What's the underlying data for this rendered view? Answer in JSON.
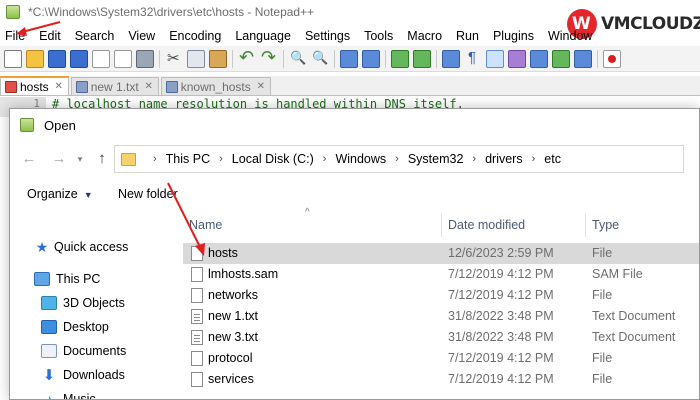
{
  "npp": {
    "title": "*C:\\Windows\\System32\\drivers\\etc\\hosts - Notepad++",
    "menu": [
      "File",
      "Edit",
      "Search",
      "View",
      "Encoding",
      "Language",
      "Settings",
      "Tools",
      "Macro",
      "Run",
      "Plugins",
      "Window"
    ],
    "tabs": [
      {
        "label": "hosts",
        "active": true
      },
      {
        "label": "new 1.txt",
        "active": false
      },
      {
        "label": "known_hosts",
        "active": false
      }
    ],
    "editor": {
      "line_number": "1",
      "code_line": "# localhost name resolution is handled within DNS itself."
    }
  },
  "logo": {
    "text": "VMCLOUDZ",
    "brand_color": "#e6262d"
  },
  "dialog": {
    "title": "Open",
    "breadcrumb": [
      "This PC",
      "Local Disk (C:)",
      "Windows",
      "System32",
      "drivers",
      "etc"
    ],
    "organize_label": "Organize",
    "new_folder_label": "New folder",
    "nav": [
      {
        "label": "Quick access",
        "icon": "star-icon"
      },
      {
        "label": "This PC",
        "icon": "computer-icon"
      },
      {
        "label": "3D Objects",
        "icon": "3d-objects-icon"
      },
      {
        "label": "Desktop",
        "icon": "desktop-icon"
      },
      {
        "label": "Documents",
        "icon": "documents-icon"
      },
      {
        "label": "Downloads",
        "icon": "download-icon"
      },
      {
        "label": "Music",
        "icon": "music-icon"
      }
    ],
    "columns": {
      "name": "Name",
      "date": "Date modified",
      "type": "Type"
    },
    "files": [
      {
        "name": "hosts",
        "date": "12/6/2023 2:59 PM",
        "type": "File",
        "selected": true
      },
      {
        "name": "lmhosts.sam",
        "date": "7/12/2019 4:12 PM",
        "type": "SAM File",
        "selected": false
      },
      {
        "name": "networks",
        "date": "7/12/2019 4:12 PM",
        "type": "File",
        "selected": false
      },
      {
        "name": "new 1.txt",
        "date": "31/8/2022 3:48 PM",
        "type": "Text Document",
        "selected": false
      },
      {
        "name": "new 3.txt",
        "date": "31/8/2022 3:48 PM",
        "type": "Text Document",
        "selected": false
      },
      {
        "name": "protocol",
        "date": "7/12/2019 4:12 PM",
        "type": "File",
        "selected": false
      },
      {
        "name": "services",
        "date": "7/12/2019 4:12 PM",
        "type": "File",
        "selected": false
      }
    ]
  },
  "annotation_color": "#e02020"
}
